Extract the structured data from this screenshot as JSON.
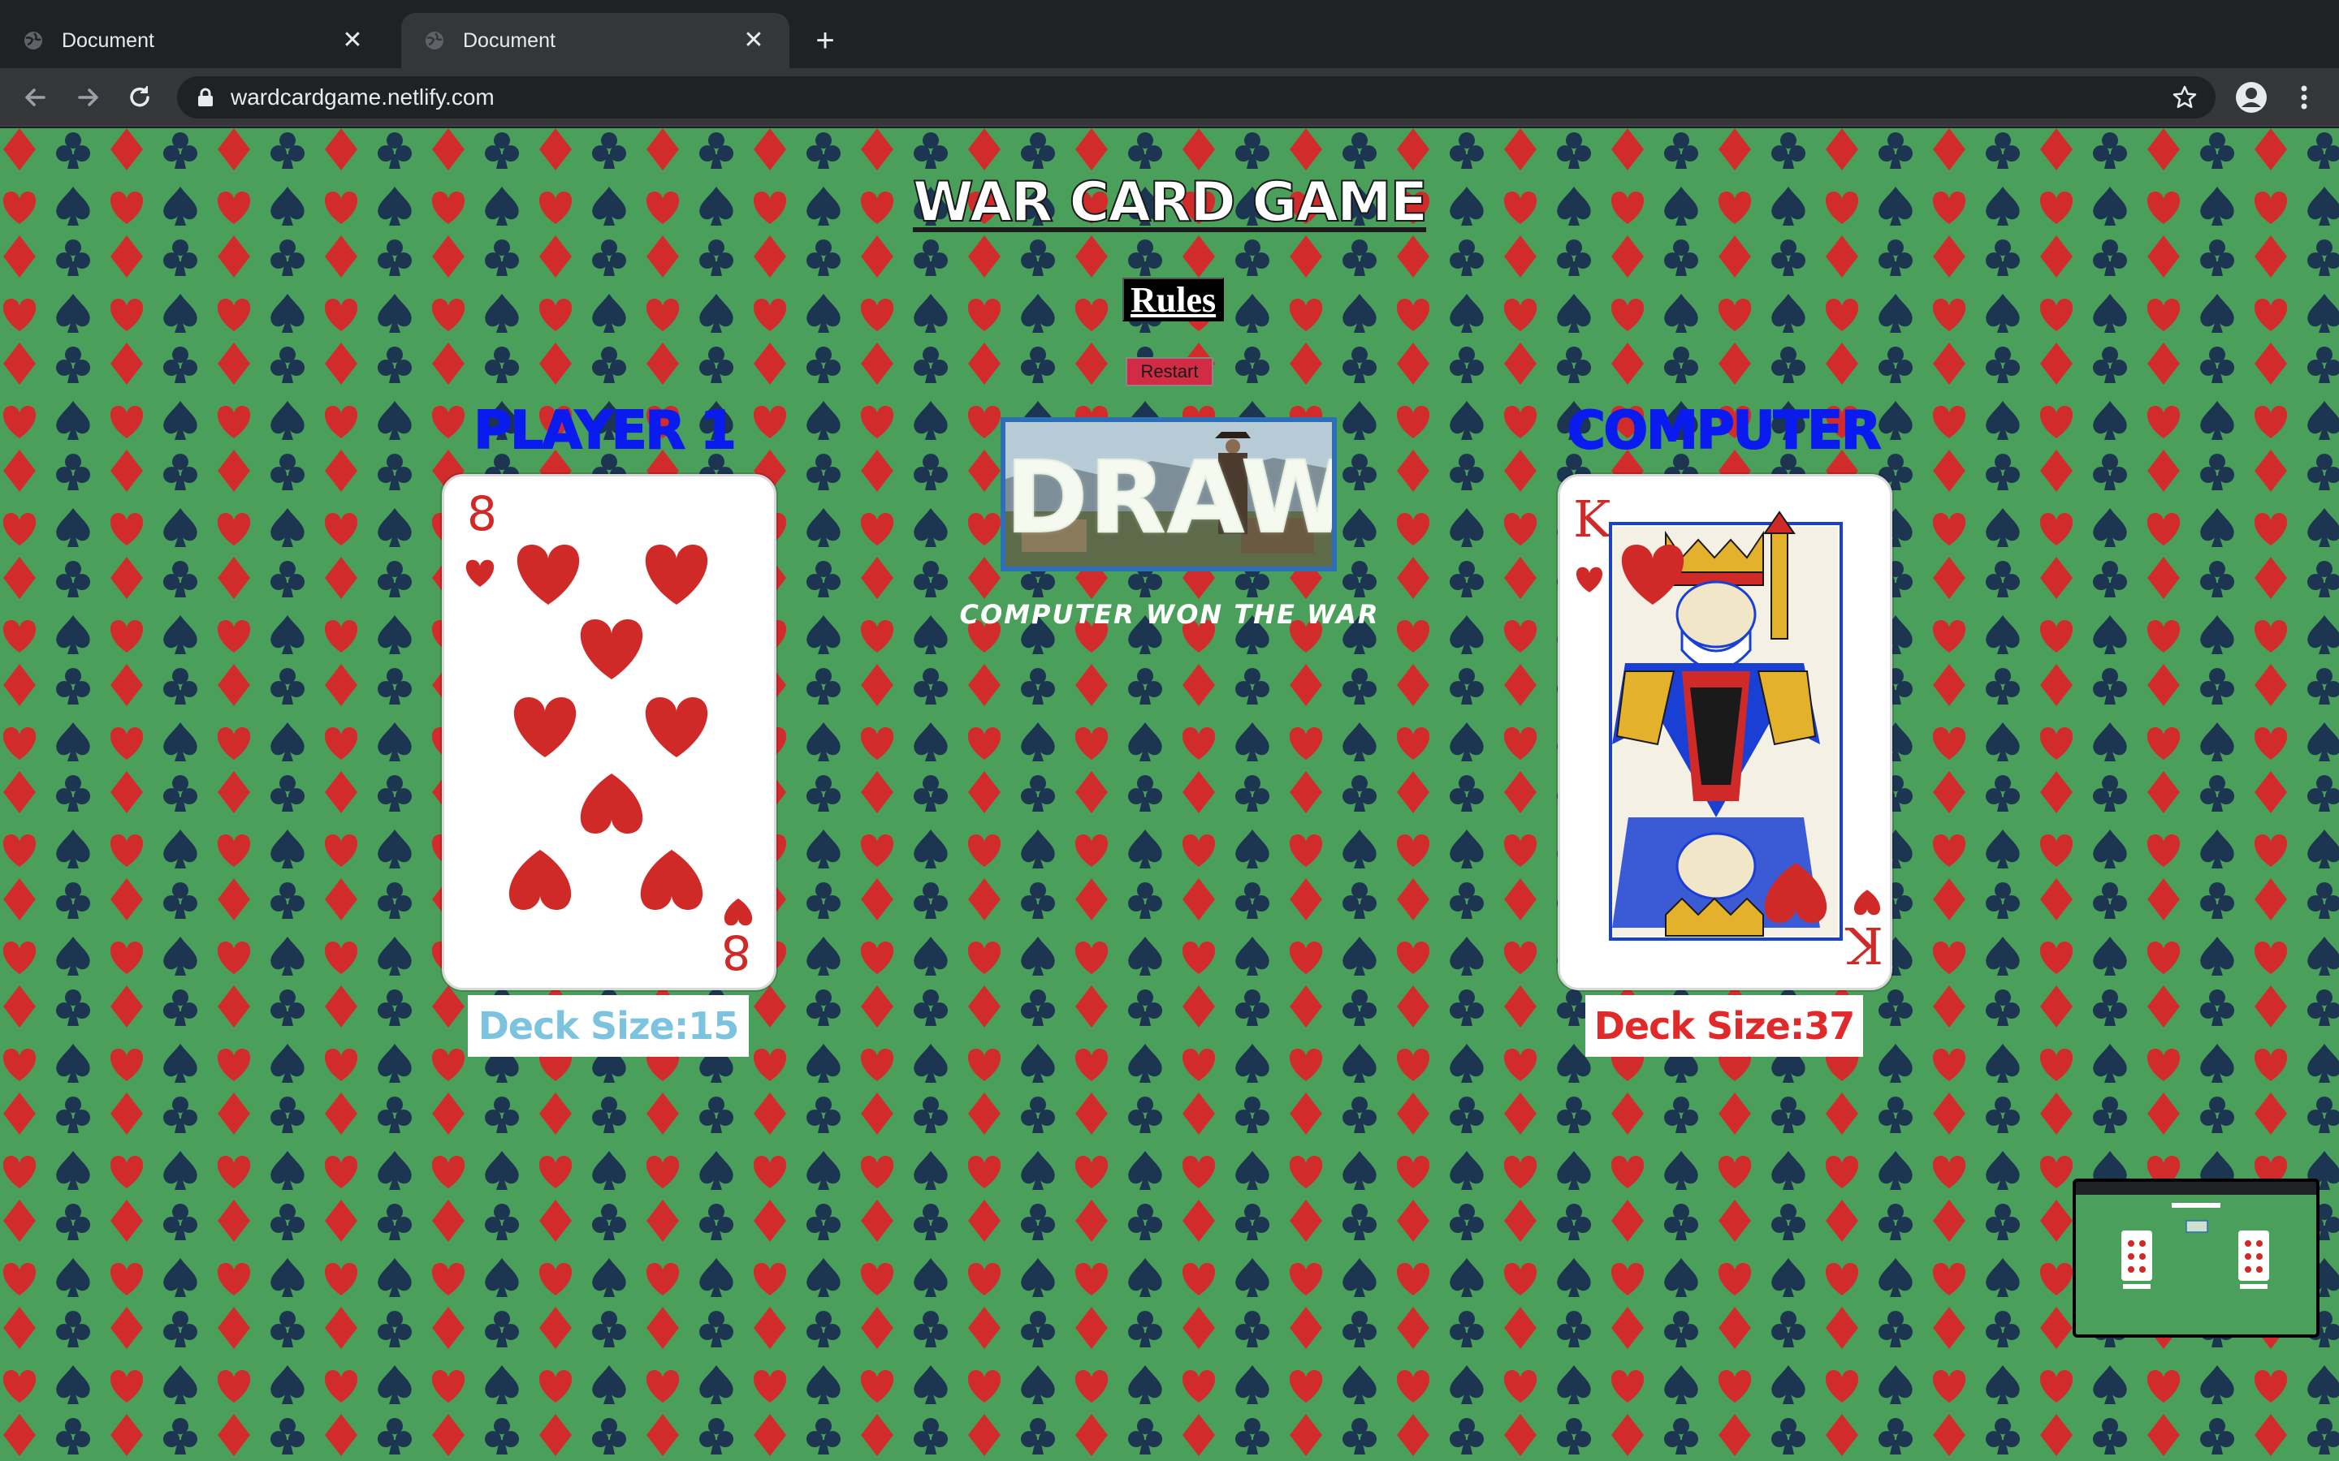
{
  "browser": {
    "tabs": [
      {
        "title": "Document",
        "active": false
      },
      {
        "title": "Document",
        "active": true
      }
    ],
    "url": "wardcardgame.netlify.com"
  },
  "game": {
    "title": "WAR CARD GAME",
    "rules_label": "Rules",
    "restart_label": "Restart",
    "draw_label": "DRAW",
    "status_message": "COMPUTER WON THE WAR",
    "player": {
      "label": "PLAYER 1",
      "card_rank": "8",
      "card_suit": "hearts",
      "deck_size_label": "Deck Size:15",
      "label_color": "#0a1bf0",
      "deck_color": "#7cc3e0"
    },
    "computer": {
      "label": "COMPUTER",
      "card_rank": "K",
      "card_suit": "hearts",
      "deck_size_label": "Deck Size:37",
      "label_color": "#0a1bf0",
      "deck_color": "#e02a2a"
    }
  },
  "colors": {
    "felt": "#4aa05b",
    "heart_red": "#d12a2a",
    "spade_navy": "#1c3550"
  }
}
